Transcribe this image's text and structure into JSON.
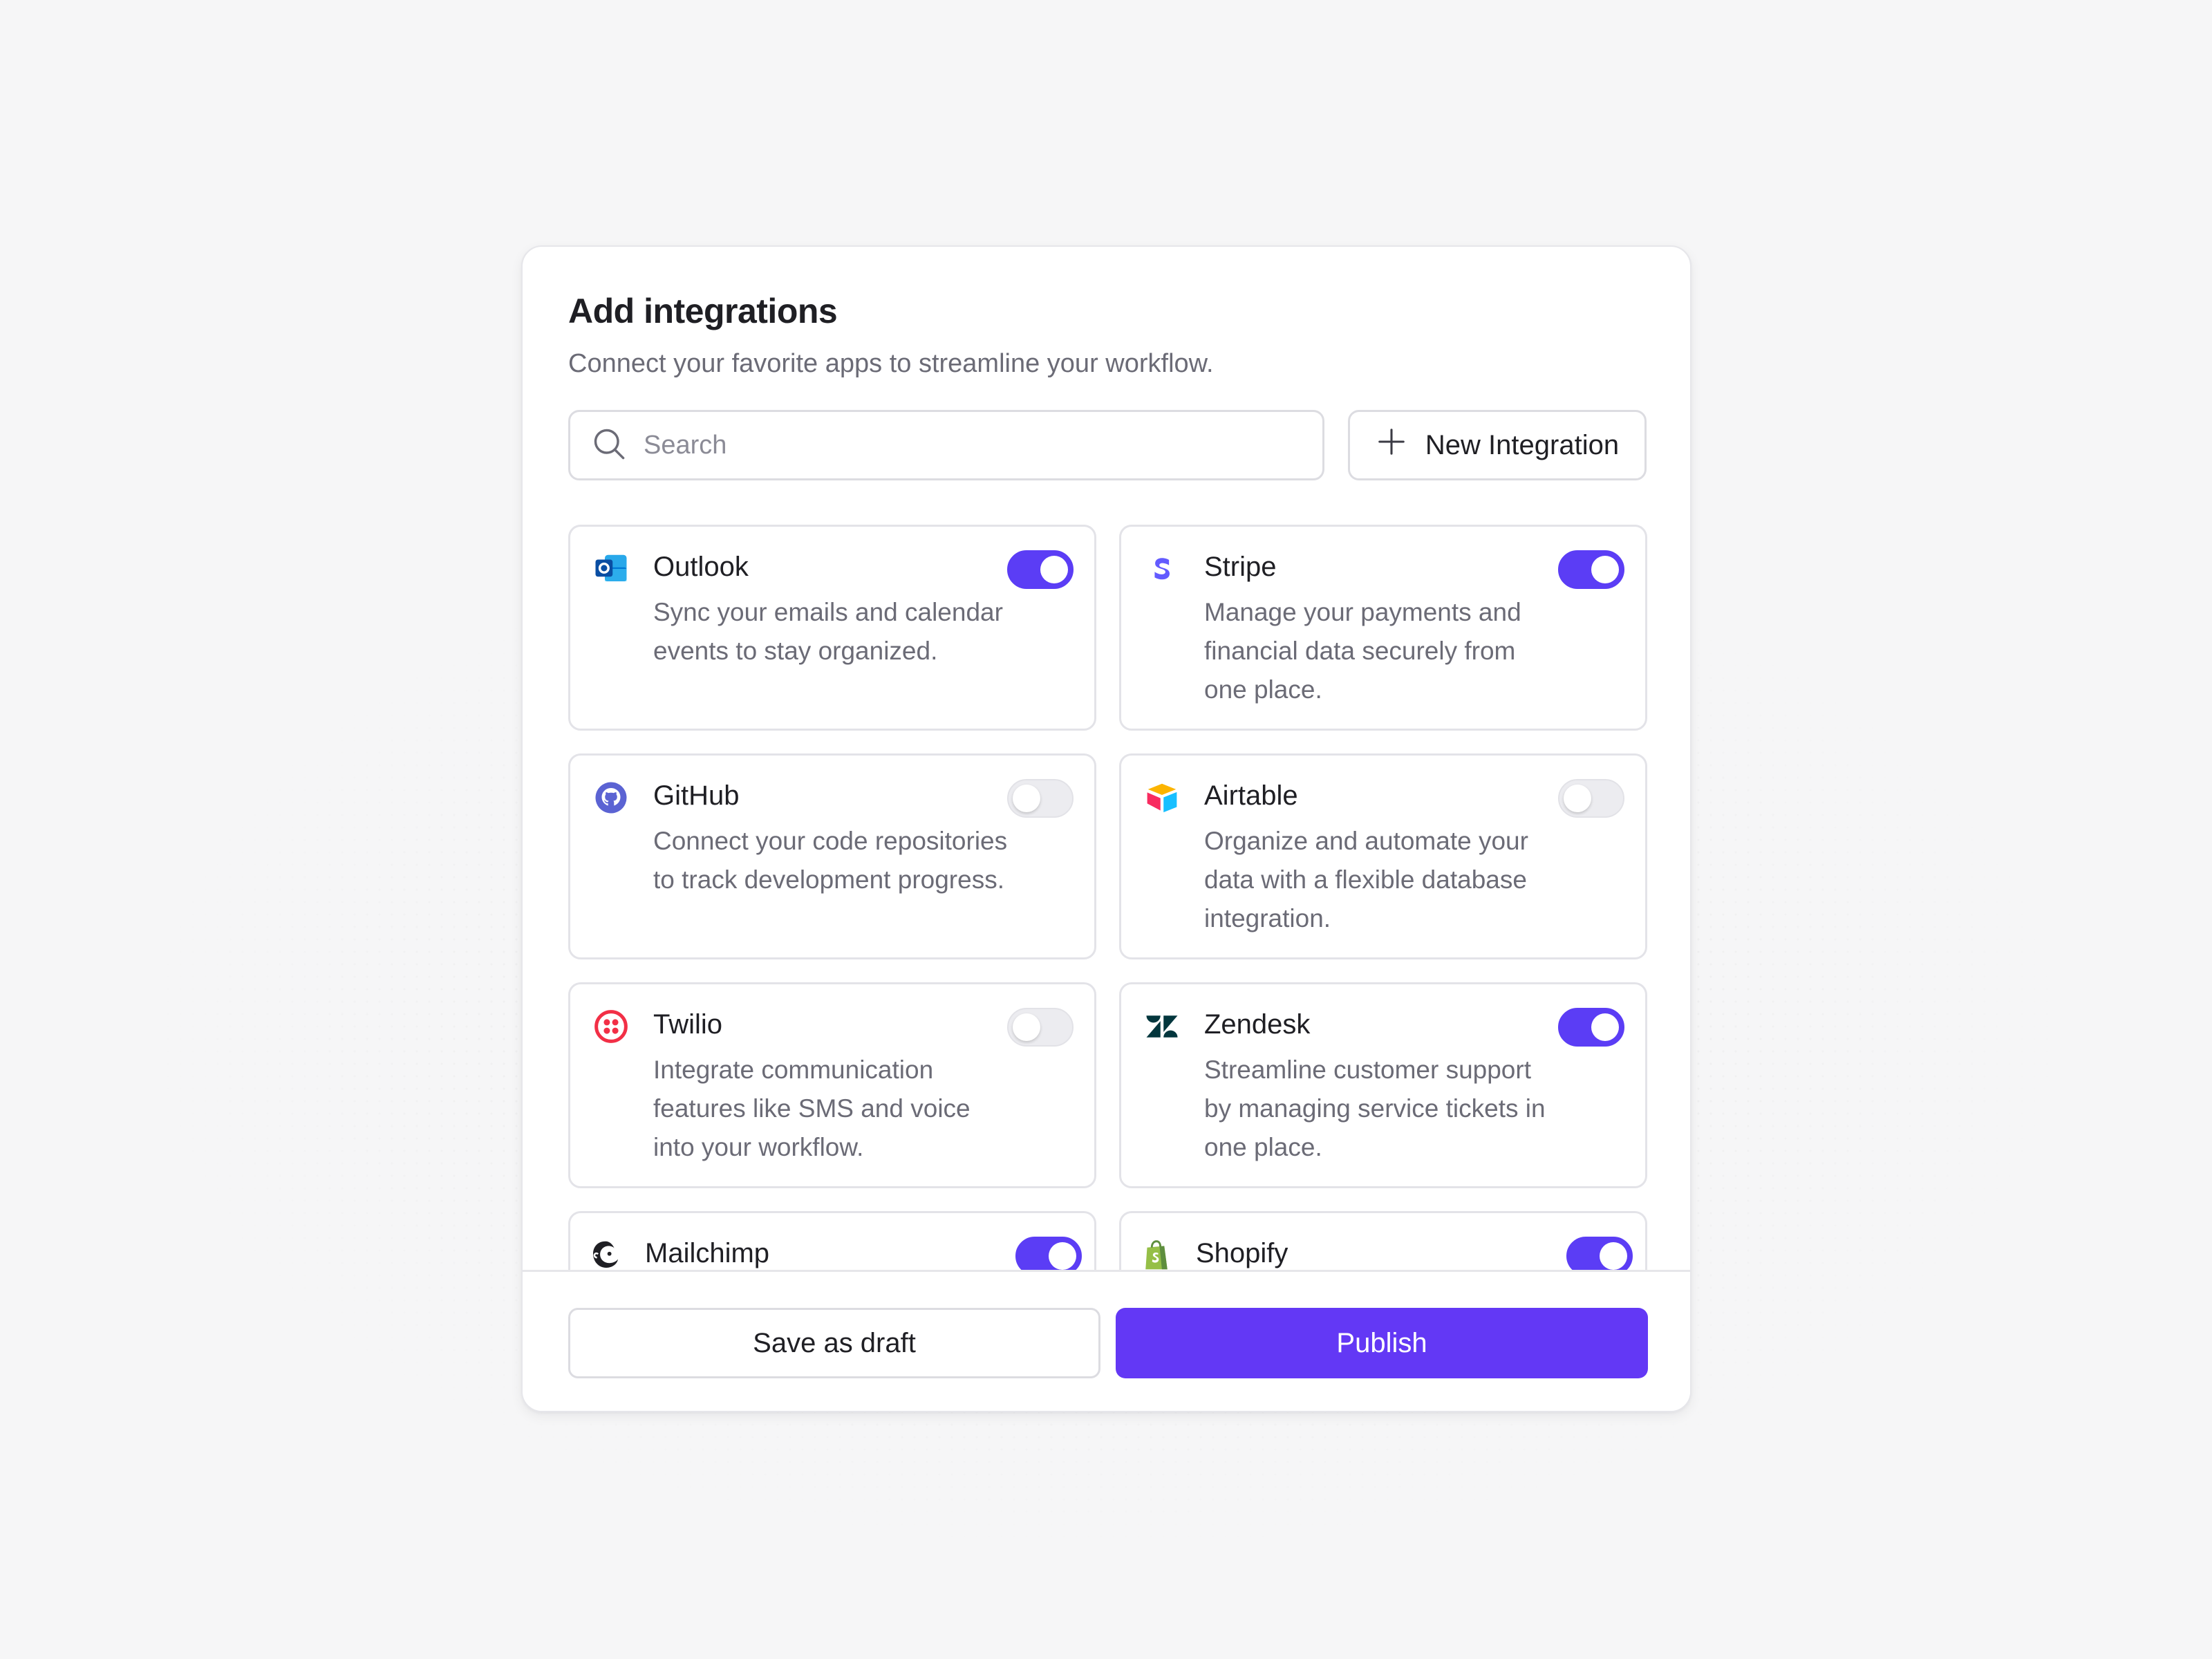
{
  "dialog": {
    "title": "Add integrations",
    "subtitle": "Connect your favorite apps to streamline your workflow."
  },
  "search": {
    "placeholder": "Search",
    "value": ""
  },
  "new_integration": {
    "label": "New Integration",
    "icon": "plus-icon"
  },
  "integrations": [
    {
      "name": "Outlook",
      "description": "Sync your emails and calendar events to stay organized.",
      "enabled": true,
      "icon": "outlook-icon"
    },
    {
      "name": "Stripe",
      "description": "Manage your payments and financial data securely from one place.",
      "enabled": true,
      "icon": "stripe-icon"
    },
    {
      "name": "GitHub",
      "description": "Connect your code repositories to track development progress.",
      "enabled": false,
      "icon": "github-icon"
    },
    {
      "name": "Airtable",
      "description": "Organize and automate your data with a flexible database integration.",
      "enabled": false,
      "icon": "airtable-icon"
    },
    {
      "name": "Twilio",
      "description": "Integrate communication features like SMS and voice into your workflow.",
      "enabled": false,
      "icon": "twilio-icon"
    },
    {
      "name": "Zendesk",
      "description": "Streamline customer support by managing service tickets in one place.",
      "enabled": true,
      "icon": "zendesk-icon"
    },
    {
      "name": "Mailchimp",
      "description": "",
      "enabled": true,
      "icon": "mailchimp-icon"
    },
    {
      "name": "Shopify",
      "description": "",
      "enabled": true,
      "icon": "shopify-icon"
    }
  ],
  "footer": {
    "draft_label": "Save as draft",
    "publish_label": "Publish"
  },
  "colors": {
    "accent": "#6338f5",
    "toggle_on": "#5b3df5",
    "toggle_off": "#ececf0",
    "background": "#f6f6f7",
    "text_secondary": "#6b6b76"
  }
}
